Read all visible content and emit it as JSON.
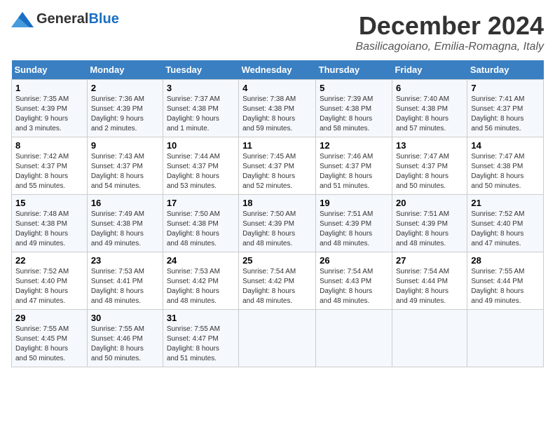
{
  "header": {
    "logo_general": "General",
    "logo_blue": "Blue",
    "month": "December 2024",
    "location": "Basilicagoiano, Emilia-Romagna, Italy"
  },
  "weekdays": [
    "Sunday",
    "Monday",
    "Tuesday",
    "Wednesday",
    "Thursday",
    "Friday",
    "Saturday"
  ],
  "weeks": [
    [
      {
        "day": "1",
        "detail": "Sunrise: 7:35 AM\nSunset: 4:39 PM\nDaylight: 9 hours\nand 3 minutes."
      },
      {
        "day": "2",
        "detail": "Sunrise: 7:36 AM\nSunset: 4:39 PM\nDaylight: 9 hours\nand 2 minutes."
      },
      {
        "day": "3",
        "detail": "Sunrise: 7:37 AM\nSunset: 4:38 PM\nDaylight: 9 hours\nand 1 minute."
      },
      {
        "day": "4",
        "detail": "Sunrise: 7:38 AM\nSunset: 4:38 PM\nDaylight: 8 hours\nand 59 minutes."
      },
      {
        "day": "5",
        "detail": "Sunrise: 7:39 AM\nSunset: 4:38 PM\nDaylight: 8 hours\nand 58 minutes."
      },
      {
        "day": "6",
        "detail": "Sunrise: 7:40 AM\nSunset: 4:38 PM\nDaylight: 8 hours\nand 57 minutes."
      },
      {
        "day": "7",
        "detail": "Sunrise: 7:41 AM\nSunset: 4:37 PM\nDaylight: 8 hours\nand 56 minutes."
      }
    ],
    [
      {
        "day": "8",
        "detail": "Sunrise: 7:42 AM\nSunset: 4:37 PM\nDaylight: 8 hours\nand 55 minutes."
      },
      {
        "day": "9",
        "detail": "Sunrise: 7:43 AM\nSunset: 4:37 PM\nDaylight: 8 hours\nand 54 minutes."
      },
      {
        "day": "10",
        "detail": "Sunrise: 7:44 AM\nSunset: 4:37 PM\nDaylight: 8 hours\nand 53 minutes."
      },
      {
        "day": "11",
        "detail": "Sunrise: 7:45 AM\nSunset: 4:37 PM\nDaylight: 8 hours\nand 52 minutes."
      },
      {
        "day": "12",
        "detail": "Sunrise: 7:46 AM\nSunset: 4:37 PM\nDaylight: 8 hours\nand 51 minutes."
      },
      {
        "day": "13",
        "detail": "Sunrise: 7:47 AM\nSunset: 4:37 PM\nDaylight: 8 hours\nand 50 minutes."
      },
      {
        "day": "14",
        "detail": "Sunrise: 7:47 AM\nSunset: 4:38 PM\nDaylight: 8 hours\nand 50 minutes."
      }
    ],
    [
      {
        "day": "15",
        "detail": "Sunrise: 7:48 AM\nSunset: 4:38 PM\nDaylight: 8 hours\nand 49 minutes."
      },
      {
        "day": "16",
        "detail": "Sunrise: 7:49 AM\nSunset: 4:38 PM\nDaylight: 8 hours\nand 49 minutes."
      },
      {
        "day": "17",
        "detail": "Sunrise: 7:50 AM\nSunset: 4:38 PM\nDaylight: 8 hours\nand 48 minutes."
      },
      {
        "day": "18",
        "detail": "Sunrise: 7:50 AM\nSunset: 4:39 PM\nDaylight: 8 hours\nand 48 minutes."
      },
      {
        "day": "19",
        "detail": "Sunrise: 7:51 AM\nSunset: 4:39 PM\nDaylight: 8 hours\nand 48 minutes."
      },
      {
        "day": "20",
        "detail": "Sunrise: 7:51 AM\nSunset: 4:39 PM\nDaylight: 8 hours\nand 48 minutes."
      },
      {
        "day": "21",
        "detail": "Sunrise: 7:52 AM\nSunset: 4:40 PM\nDaylight: 8 hours\nand 47 minutes."
      }
    ],
    [
      {
        "day": "22",
        "detail": "Sunrise: 7:52 AM\nSunset: 4:40 PM\nDaylight: 8 hours\nand 47 minutes."
      },
      {
        "day": "23",
        "detail": "Sunrise: 7:53 AM\nSunset: 4:41 PM\nDaylight: 8 hours\nand 48 minutes."
      },
      {
        "day": "24",
        "detail": "Sunrise: 7:53 AM\nSunset: 4:42 PM\nDaylight: 8 hours\nand 48 minutes."
      },
      {
        "day": "25",
        "detail": "Sunrise: 7:54 AM\nSunset: 4:42 PM\nDaylight: 8 hours\nand 48 minutes."
      },
      {
        "day": "26",
        "detail": "Sunrise: 7:54 AM\nSunset: 4:43 PM\nDaylight: 8 hours\nand 48 minutes."
      },
      {
        "day": "27",
        "detail": "Sunrise: 7:54 AM\nSunset: 4:44 PM\nDaylight: 8 hours\nand 49 minutes."
      },
      {
        "day": "28",
        "detail": "Sunrise: 7:55 AM\nSunset: 4:44 PM\nDaylight: 8 hours\nand 49 minutes."
      }
    ],
    [
      {
        "day": "29",
        "detail": "Sunrise: 7:55 AM\nSunset: 4:45 PM\nDaylight: 8 hours\nand 50 minutes."
      },
      {
        "day": "30",
        "detail": "Sunrise: 7:55 AM\nSunset: 4:46 PM\nDaylight: 8 hours\nand 50 minutes."
      },
      {
        "day": "31",
        "detail": "Sunrise: 7:55 AM\nSunset: 4:47 PM\nDaylight: 8 hours\nand 51 minutes."
      },
      {
        "day": "",
        "detail": ""
      },
      {
        "day": "",
        "detail": ""
      },
      {
        "day": "",
        "detail": ""
      },
      {
        "day": "",
        "detail": ""
      }
    ]
  ]
}
